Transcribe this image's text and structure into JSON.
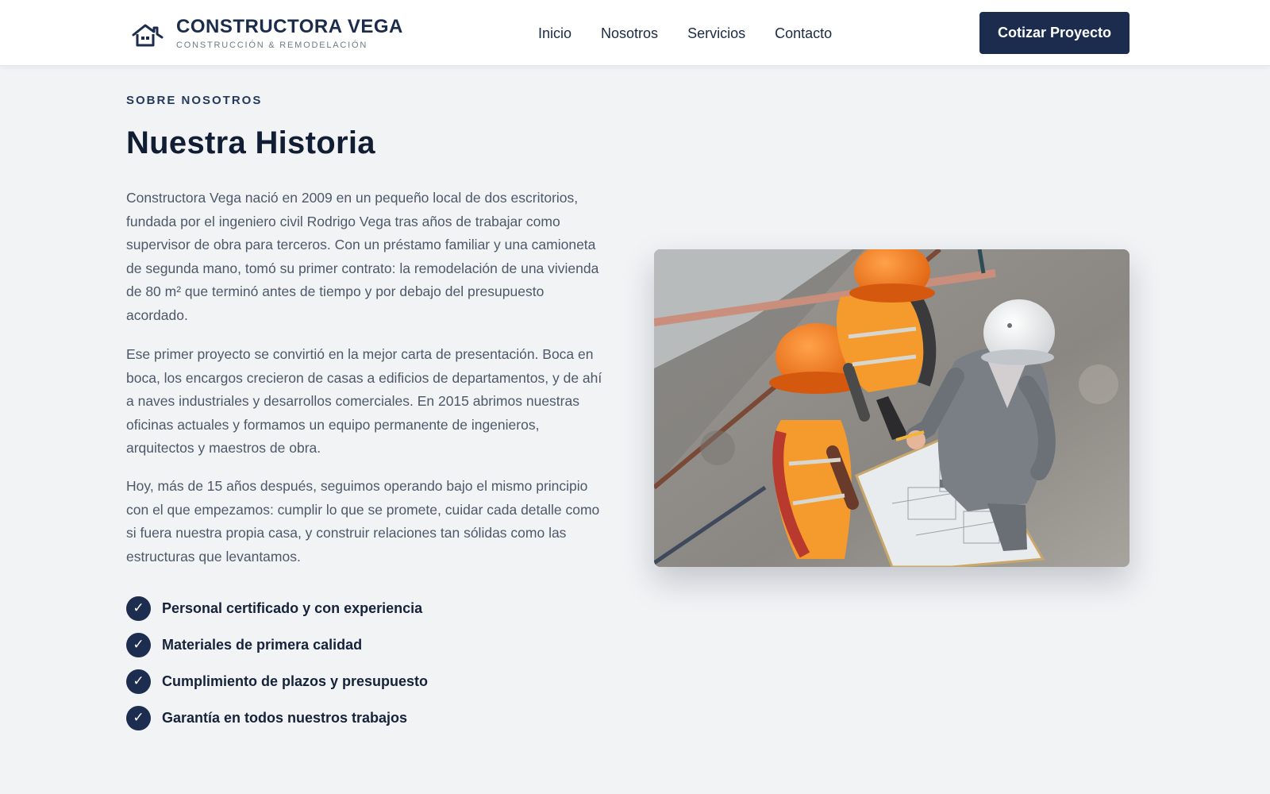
{
  "header": {
    "logo_name": "CONSTRUCTORA VEGA",
    "logo_tagline": "CONSTRUCCIÓN & REMODELACIÓN",
    "logo_icon": "house-icon",
    "nav": [
      "Inicio",
      "Nosotros",
      "Servicios",
      "Contacto"
    ],
    "cta_label": "Cotizar Proyecto"
  },
  "about": {
    "eyebrow": "SOBRE NOSOTROS",
    "title": "Nuestra Historia",
    "paragraphs": [
      "Constructora Vega nació en 2009 en un pequeño local de dos escritorios, fundada por el ingeniero civil Rodrigo Vega tras años de trabajar como supervisor de obra para terceros. Con un préstamo familiar y una camioneta de segunda mano, tomó su primer contrato: la remodelación de una vivienda de 80 m² que terminó antes de tiempo y por debajo del presupuesto acordado.",
      "Ese primer proyecto se convirtió en la mejor carta de presentación. Boca en boca, los encargos crecieron de casas a edificios de departamentos, y de ahí a naves industriales y desarrollos comerciales. En 2015 abrimos nuestras oficinas actuales y formamos un equipo permanente de ingenieros, arquitectos y maestros de obra.",
      "Hoy, más de 15 años después, seguimos operando bajo el mismo principio con el que empezamos: cumplir lo que se promete, cuidar cada detalle como si fuera nuestra propia casa, y construir relaciones tan sólidas como las estructuras que levantamos."
    ],
    "features": [
      "Personal certificado y con experiencia",
      "Materiales de primera calidad",
      "Cumplimiento de plazos y presupuesto",
      "Garantía en todos nuestros trabajos"
    ],
    "check_glyph": "✓",
    "check_icon": "check-circle-icon"
  },
  "colors": {
    "navy": "#1c2c4e",
    "background": "#f1f3f5",
    "body_text": "#4d5869",
    "hardhat_orange": "#f07a1a",
    "vest_orange": "#f59a2c"
  }
}
